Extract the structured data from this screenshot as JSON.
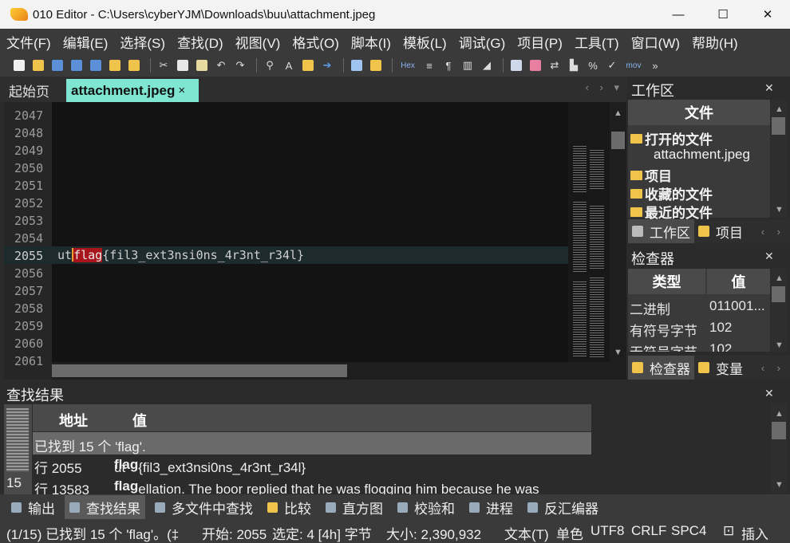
{
  "window": {
    "title": "010 Editor - C:\\Users\\cyberYJM\\Downloads\\buu\\attachment.jpeg",
    "minimize": "—",
    "maximize": "☐",
    "close": "✕"
  },
  "menu": [
    "文件(F)",
    "编辑(E)",
    "选择(S)",
    "查找(D)",
    "视图(V)",
    "格式(O)",
    "脚本(I)",
    "模板(L)",
    "调试(G)",
    "项目(P)",
    "工具(T)",
    "窗口(W)",
    "帮助(H)"
  ],
  "toolbar": {
    "hex_label": "Hex",
    "mov_label": "mov"
  },
  "tabs": {
    "start": "起始页",
    "active": "attachment.jpeg",
    "close": "×",
    "nav": "‹ › ▾"
  },
  "editor": {
    "lines": [
      {
        "num": "2047",
        "text": ""
      },
      {
        "num": "2048",
        "text": ""
      },
      {
        "num": "2049",
        "text": ""
      },
      {
        "num": "2050",
        "text": ""
      },
      {
        "num": "2051",
        "text": ""
      },
      {
        "num": "2052",
        "text": ""
      },
      {
        "num": "2053",
        "text": ""
      },
      {
        "num": "2054",
        "text": ""
      },
      {
        "num": "2055",
        "text_pre": "ut",
        "text_hit": "flag",
        "text_post": "{fil3_ext3nsi0ns_4r3nt_r34l}"
      },
      {
        "num": "2056",
        "text": ""
      },
      {
        "num": "2057",
        "text": ""
      },
      {
        "num": "2058",
        "text": ""
      },
      {
        "num": "2059",
        "text": ""
      },
      {
        "num": "2060",
        "text": ""
      },
      {
        "num": "2061",
        "text": ""
      }
    ]
  },
  "workspace": {
    "title": "工作区",
    "header": "文件",
    "open_files": "打开的文件",
    "file": "attachment.jpeg",
    "projects": "项目",
    "favorites": "收藏的文件",
    "recent": "最近的文件",
    "tab_workspace": "工作区",
    "tab_project": "项目"
  },
  "inspector": {
    "title": "检查器",
    "col_type": "类型",
    "col_value": "值",
    "rows": [
      {
        "type": "二进制",
        "value": "011001..."
      },
      {
        "type": "有符号字节",
        "value": "102"
      },
      {
        "type": "无符号字节",
        "value": "102"
      }
    ],
    "tab_inspector": "检查器",
    "tab_variables": "变量"
  },
  "find": {
    "title": "查找结果",
    "count": "15",
    "col_address": "地址",
    "col_value": "值",
    "summary": "已找到 15 个 'flag'.",
    "results": [
      {
        "addr": "行 2055",
        "pre": "ut",
        "hit": "flag",
        "post": "{fil3_ext3nsi0ns_4r3nt_r34l}"
      },
      {
        "addr": "行 13583",
        "pre": "",
        "hit": "flag",
        "post": "ellation. The boor replied that he was flogging him because he was"
      }
    ]
  },
  "bottom_tabs": [
    "输出",
    "查找结果",
    "多文件中查找",
    "比较",
    "直方图",
    "校验和",
    "进程",
    "反汇编器"
  ],
  "status": {
    "message": "(1/15) 已找到 15 个 'flag'。(‡",
    "start": "开始: 2055",
    "selection": "选定: 4 [4h] 字节",
    "size": "大小: 2,390,932",
    "mode": "文本(T)",
    "color": "单色",
    "encoding": "UTF8",
    "eol": "CRLF",
    "tab": "SPC4",
    "insert": "插入"
  }
}
